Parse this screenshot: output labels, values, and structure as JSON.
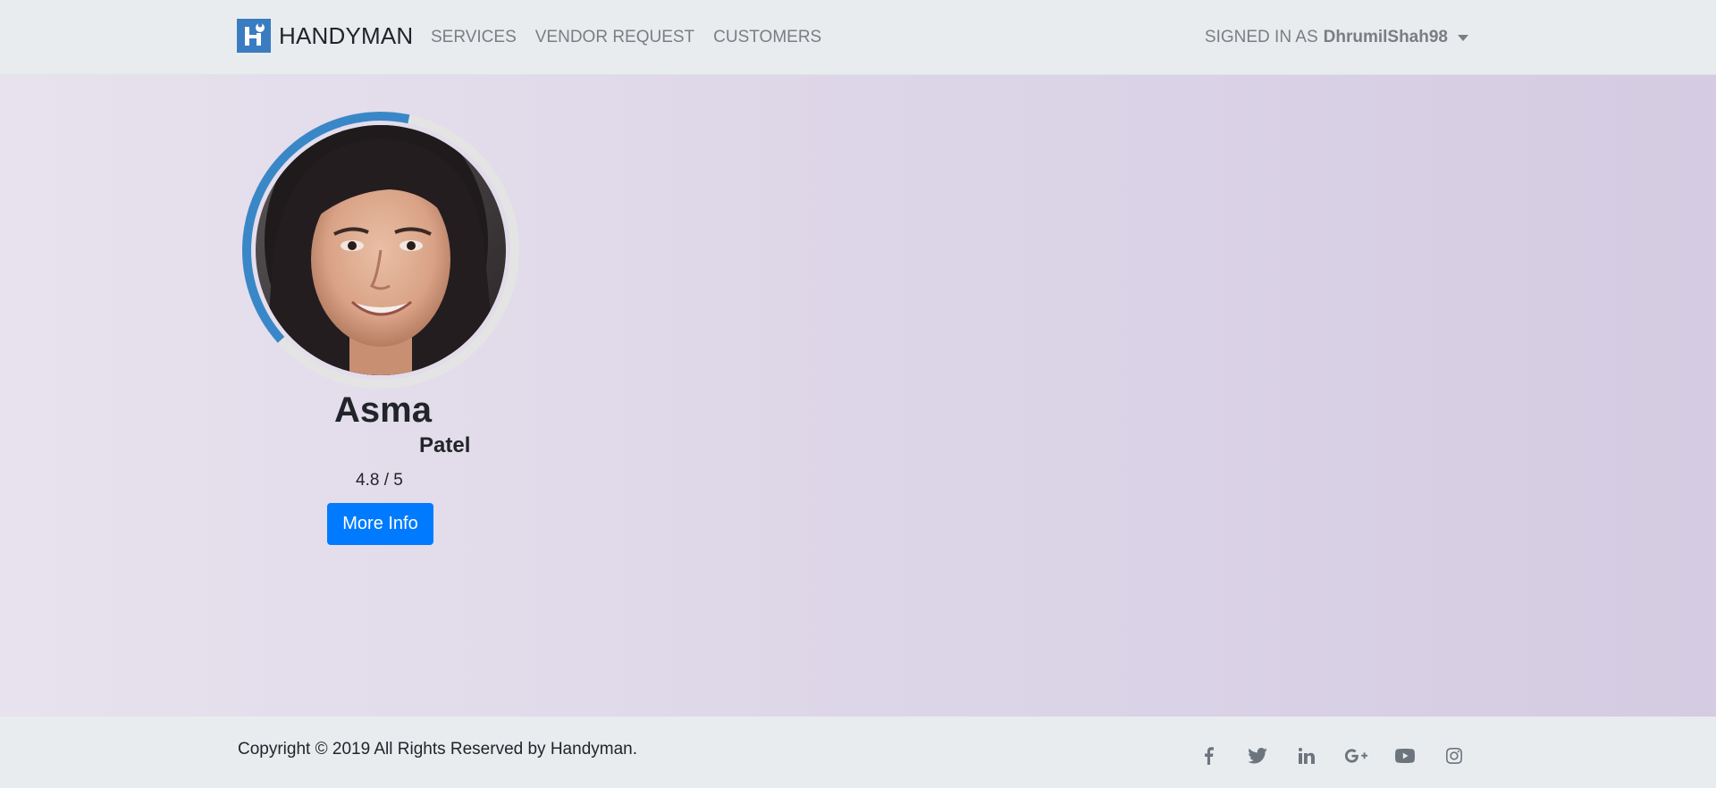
{
  "navbar": {
    "brand": "HANDYMAN",
    "brand_icon": "handyman-logo-icon",
    "links": [
      {
        "label": "SERVICES"
      },
      {
        "label": "VENDOR REQUEST"
      },
      {
        "label": "CUSTOMERS"
      }
    ],
    "signed_in_prefix": "SIGNED IN AS",
    "username": "DhrumilShah98"
  },
  "profile": {
    "first_name": "Asma",
    "last_name": "Patel",
    "rating": "4.8 / 5",
    "rating_fraction": 0.4,
    "button_label": "More Info",
    "avatar_icon": "profile-photo"
  },
  "footer": {
    "copyright": "Copyright © 2019 All Rights Reserved by Handyman.",
    "social": [
      {
        "icon": "facebook-icon"
      },
      {
        "icon": "twitter-icon"
      },
      {
        "icon": "linkedin-icon"
      },
      {
        "icon": "google-plus-icon"
      },
      {
        "icon": "youtube-icon"
      },
      {
        "icon": "instagram-icon"
      }
    ]
  },
  "colors": {
    "accent": "#007bff",
    "ring": "#3a87c8",
    "ring_track": "#e4e4e4",
    "logo": "#3a7cc2"
  }
}
